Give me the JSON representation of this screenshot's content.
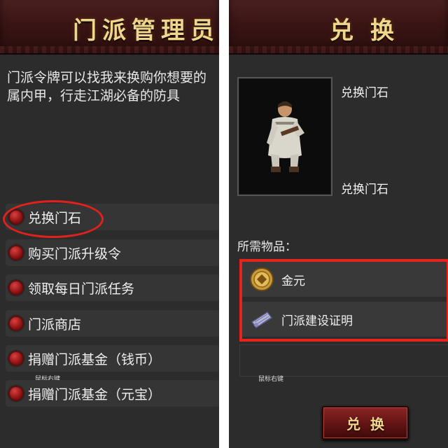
{
  "left_panel": {
    "title": "门派管理员",
    "description": "门派令牌可以找我来换购你想要的\n属内甲，行走江湖必备的防具",
    "menu": [
      {
        "label": "兑换门石"
      },
      {
        "label": "购买门派升级令"
      },
      {
        "label": "领取每日门派任务"
      },
      {
        "label": "门派商店"
      },
      {
        "label": "捐赠门派基金（钱币）"
      },
      {
        "label": "捐赠门派基金（元宝）"
      }
    ],
    "tooltip": "鼠标右键"
  },
  "right_panel": {
    "title": "兑换",
    "item_name_top": "兑换门石",
    "item_name_bottom": "兑换门石",
    "required_label": "所需物品：",
    "required_items": [
      {
        "label": "金元",
        "icon": "gold-coin-icon"
      },
      {
        "label": "门派建设证明",
        "icon": "certificate-scroll-icon"
      }
    ],
    "tooltip": "鼠标右键",
    "exchange_button": "兑换"
  },
  "colors": {
    "panel_bg": "#2c2c2c",
    "title_gold": "#f0d58c",
    "highlight_red": "#e0211c"
  }
}
